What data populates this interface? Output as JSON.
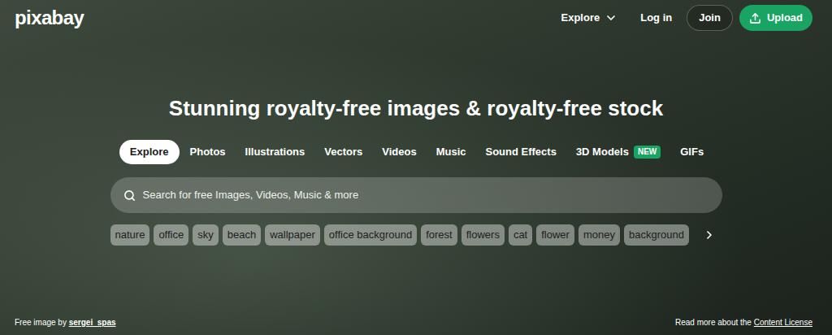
{
  "header": {
    "logo": "pixabay",
    "nav": [
      {
        "label": "Explore",
        "kind": "dropdown"
      },
      {
        "label": "Log in",
        "kind": "link"
      },
      {
        "label": "Join",
        "kind": "outline"
      },
      {
        "label": "Upload",
        "kind": "primary"
      }
    ]
  },
  "hero": {
    "heading": "Stunning royalty-free images & royalty-free stock"
  },
  "tabs": [
    {
      "label": "Explore",
      "selected": true,
      "badge": ""
    },
    {
      "label": "Photos",
      "selected": false,
      "badge": ""
    },
    {
      "label": "Illustrations",
      "selected": false,
      "badge": ""
    },
    {
      "label": "Vectors",
      "selected": false,
      "badge": ""
    },
    {
      "label": "Videos",
      "selected": false,
      "badge": ""
    },
    {
      "label": "Music",
      "selected": false,
      "badge": ""
    },
    {
      "label": "Sound Effects",
      "selected": false,
      "badge": ""
    },
    {
      "label": "3D Models",
      "selected": false,
      "badge": "NEW"
    },
    {
      "label": "GIFs",
      "selected": false,
      "badge": ""
    }
  ],
  "search": {
    "placeholder": "Search for free Images, Videos, Music & more"
  },
  "tags": [
    "nature",
    "office",
    "sky",
    "beach",
    "wallpaper",
    "office background",
    "forest",
    "flowers",
    "cat",
    "flower",
    "money",
    "background"
  ],
  "footer": {
    "credit_prefix": "Free image by",
    "credit_author": "sergei_spas",
    "license_prefix": "Read more about the",
    "license_link": "Content License"
  }
}
